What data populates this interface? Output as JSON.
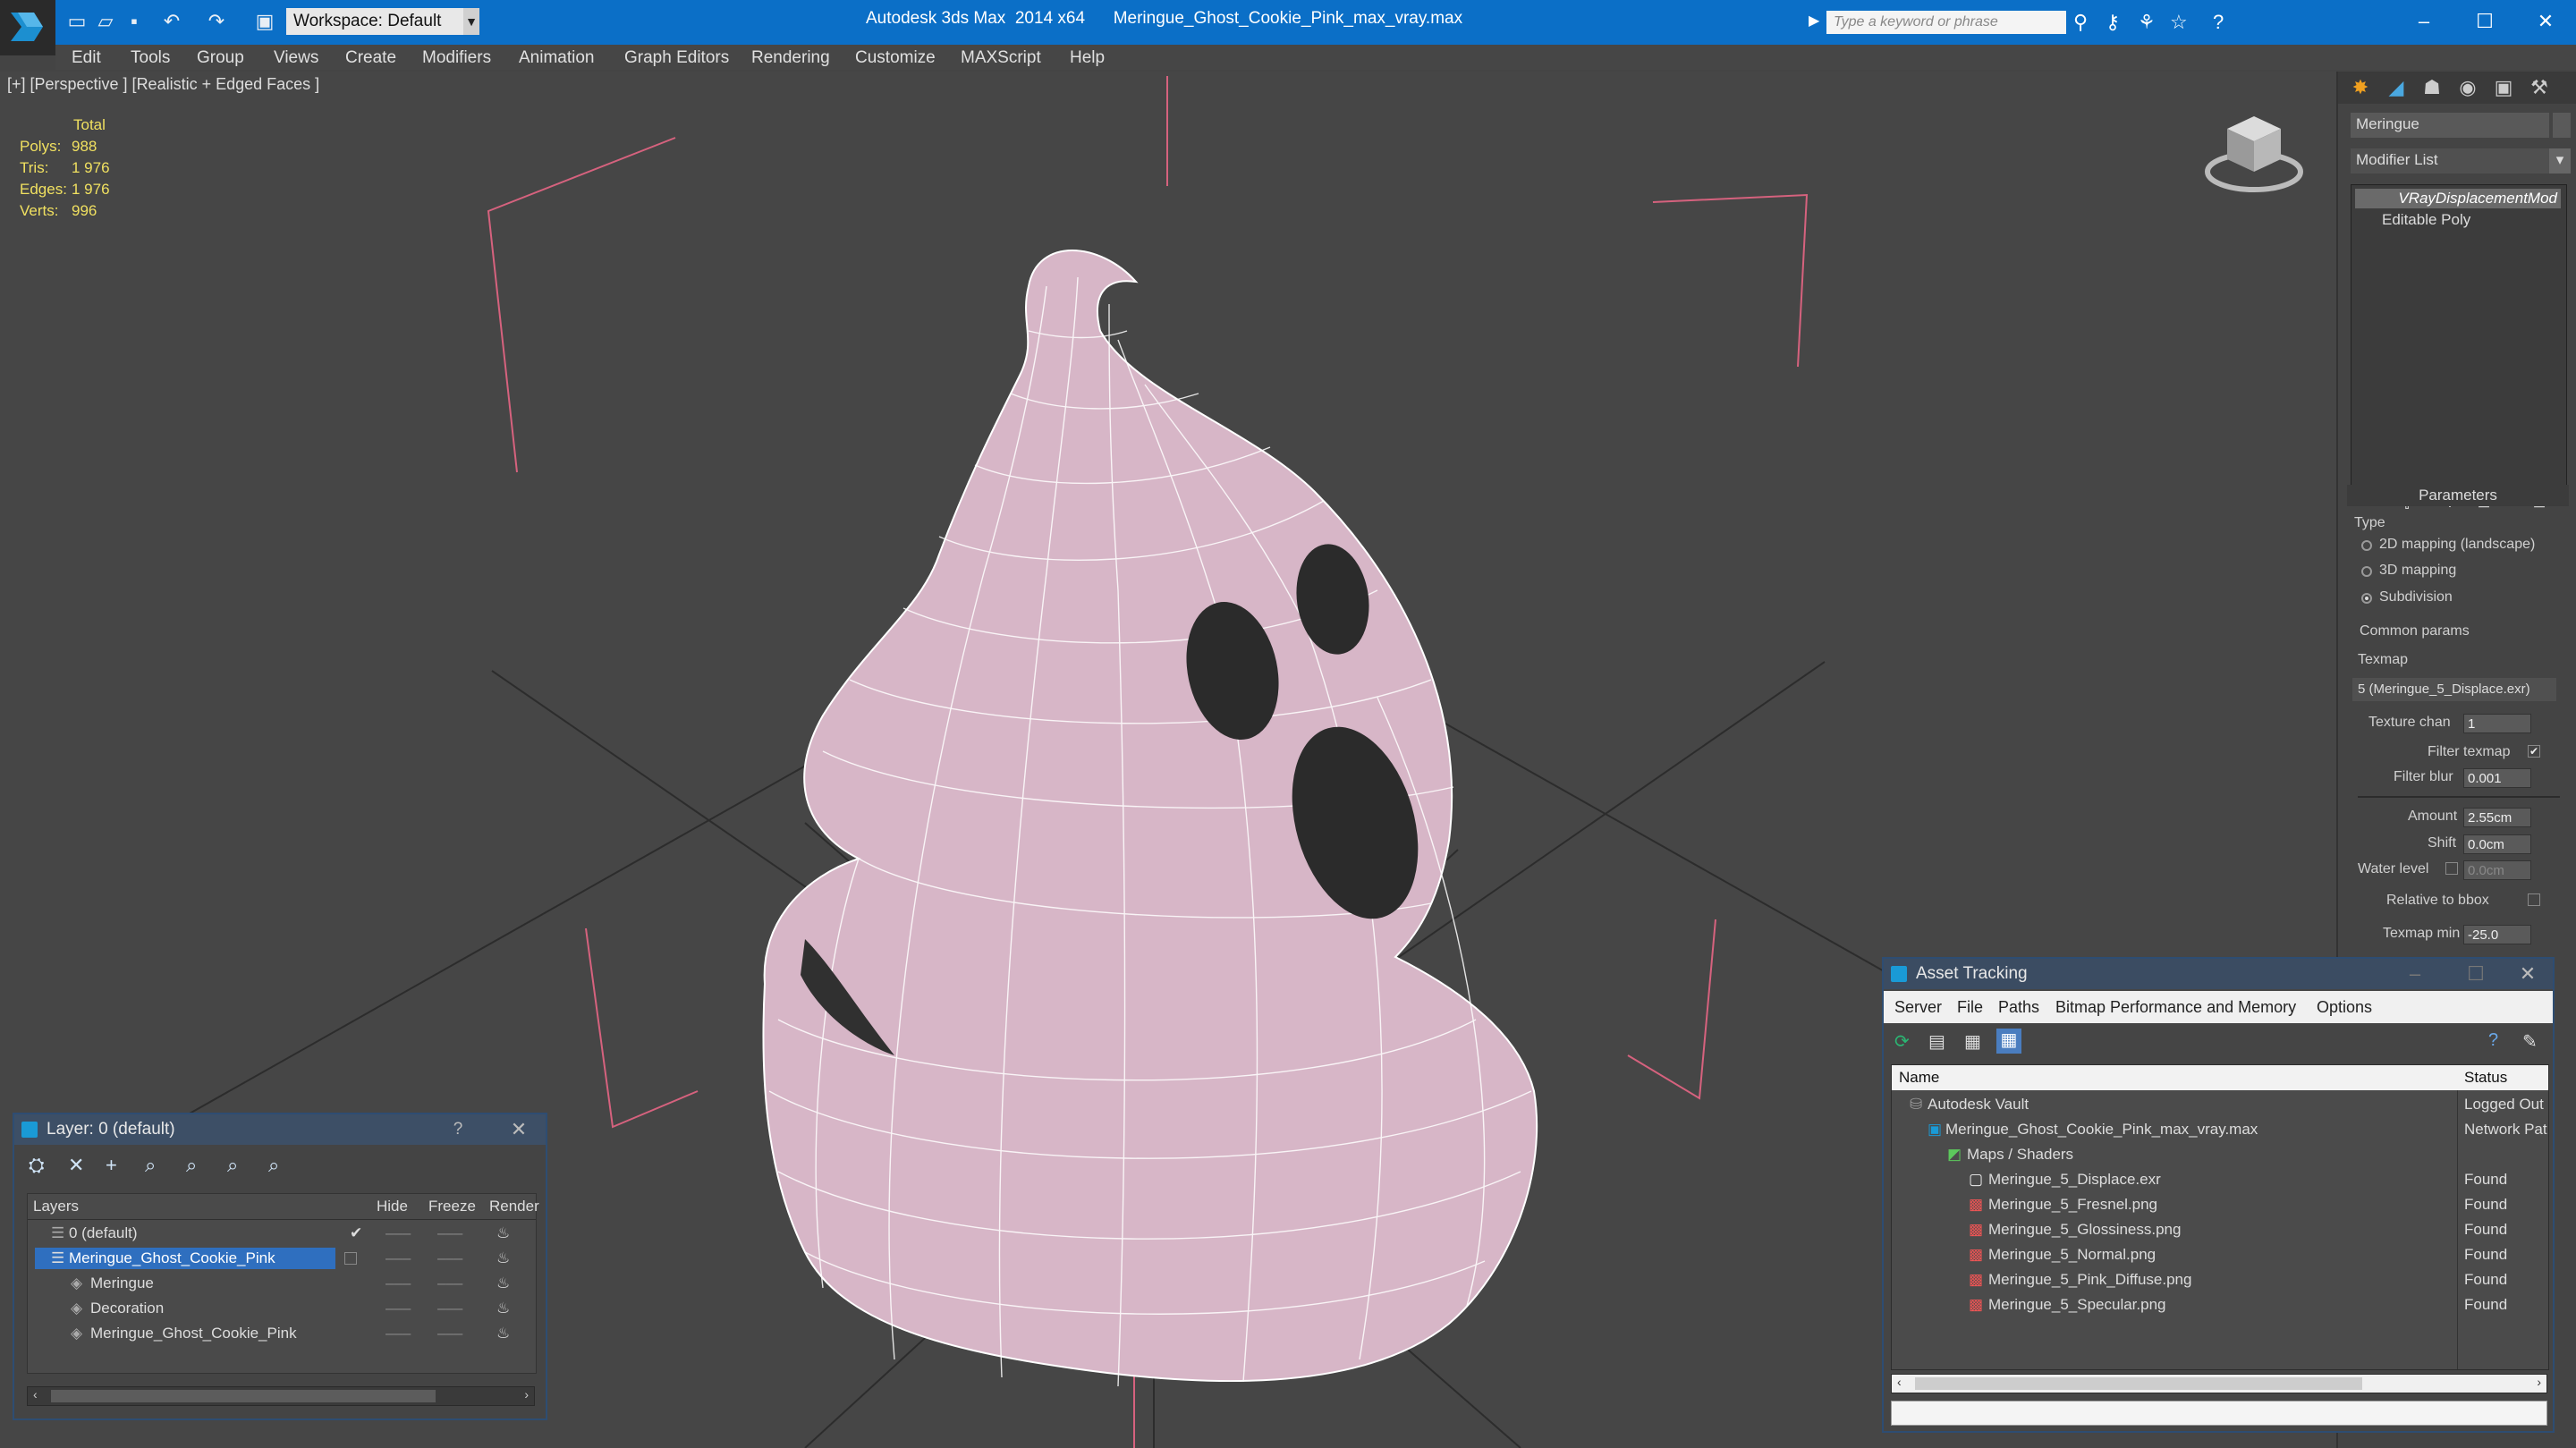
{
  "window": {
    "title": "Autodesk 3ds Max  2014 x64      Meringue_Ghost_Cookie_Pink_max_vray.max",
    "workspace": "Workspace: Default",
    "search_placeholder": "Type a keyword or phrase",
    "accent": "#0b6fc7"
  },
  "menu": [
    "Edit",
    "Tools",
    "Group",
    "Views",
    "Create",
    "Modifiers",
    "Animation",
    "Graph Editors",
    "Rendering",
    "Customize",
    "MAXScript",
    "Help"
  ],
  "viewport": {
    "label": "[+] [Perspective ] [Realistic + Edged Faces ]",
    "stats_header": "Total",
    "stats": [
      {
        "k": "Polys:",
        "v": "988"
      },
      {
        "k": "Tris:",
        "v": "1 976"
      },
      {
        "k": "Edges:",
        "v": "1 976"
      },
      {
        "k": "Verts:",
        "v": "996"
      }
    ],
    "model_color": "#d9b7c9"
  },
  "command_panel": {
    "object_name": "Meringue",
    "modifier_list": "Modifier List",
    "stack": [
      "VRayDisplacementMod",
      "Editable Poly"
    ],
    "rollout": "Parameters",
    "type_label": "Type",
    "type_options": [
      {
        "label": "2D mapping (landscape)",
        "selected": false
      },
      {
        "label": "3D mapping",
        "selected": false
      },
      {
        "label": "Subdivision",
        "selected": true
      }
    ],
    "common_params": "Common params",
    "texmap_label": "Texmap",
    "texmap_value": "5 (Meringue_5_Displace.exr)",
    "texture_chan_label": "Texture chan",
    "texture_chan": "1",
    "filter_texmap_label": "Filter texmap",
    "filter_blur_label": "Filter blur",
    "filter_blur": "0.001",
    "amount_label": "Amount",
    "amount": "2.55cm",
    "shift_label": "Shift",
    "shift": "0.0cm",
    "water_level_label": "Water level",
    "water_level": "0.0cm",
    "relative_bbox_label": "Relative to bbox",
    "texmap_min_label": "Texmap min",
    "texmap_min": "-25.0"
  },
  "layer_window": {
    "title": "Layer: 0 (default)",
    "help": "?",
    "columns": [
      "Layers",
      "Hide",
      "Freeze",
      "Render"
    ],
    "rows": [
      {
        "name": "0 (default)",
        "indent": 0,
        "selected": false,
        "check": "✔"
      },
      {
        "name": "Meringue_Ghost_Cookie_Pink",
        "indent": 0,
        "selected": true,
        "check": ""
      },
      {
        "name": "Meringue",
        "indent": 1,
        "selected": false,
        "check": ""
      },
      {
        "name": "Decoration",
        "indent": 1,
        "selected": false,
        "check": ""
      },
      {
        "name": "Meringue_Ghost_Cookie_Pink",
        "indent": 1,
        "selected": false,
        "check": ""
      }
    ]
  },
  "asset_window": {
    "title": "Asset Tracking",
    "menu": [
      "Server",
      "File",
      "Paths",
      "Bitmap Performance and Memory",
      "Options"
    ],
    "columns": [
      "Name",
      "Status"
    ],
    "rows": [
      {
        "name": "Autodesk Vault",
        "indent": 0,
        "status": "Logged Out"
      },
      {
        "name": "Meringue_Ghost_Cookie_Pink_max_vray.max",
        "indent": 1,
        "status": "Network Pat"
      },
      {
        "name": "Maps / Shaders",
        "indent": 2,
        "status": ""
      },
      {
        "name": "Meringue_5_Displace.exr",
        "indent": 3,
        "status": "Found"
      },
      {
        "name": "Meringue_5_Fresnel.png",
        "indent": 3,
        "status": "Found"
      },
      {
        "name": "Meringue_5_Glossiness.png",
        "indent": 3,
        "status": "Found"
      },
      {
        "name": "Meringue_5_Normal.png",
        "indent": 3,
        "status": "Found"
      },
      {
        "name": "Meringue_5_Pink_Diffuse.png",
        "indent": 3,
        "status": "Found"
      },
      {
        "name": "Meringue_5_Specular.png",
        "indent": 3,
        "status": "Found"
      }
    ]
  }
}
